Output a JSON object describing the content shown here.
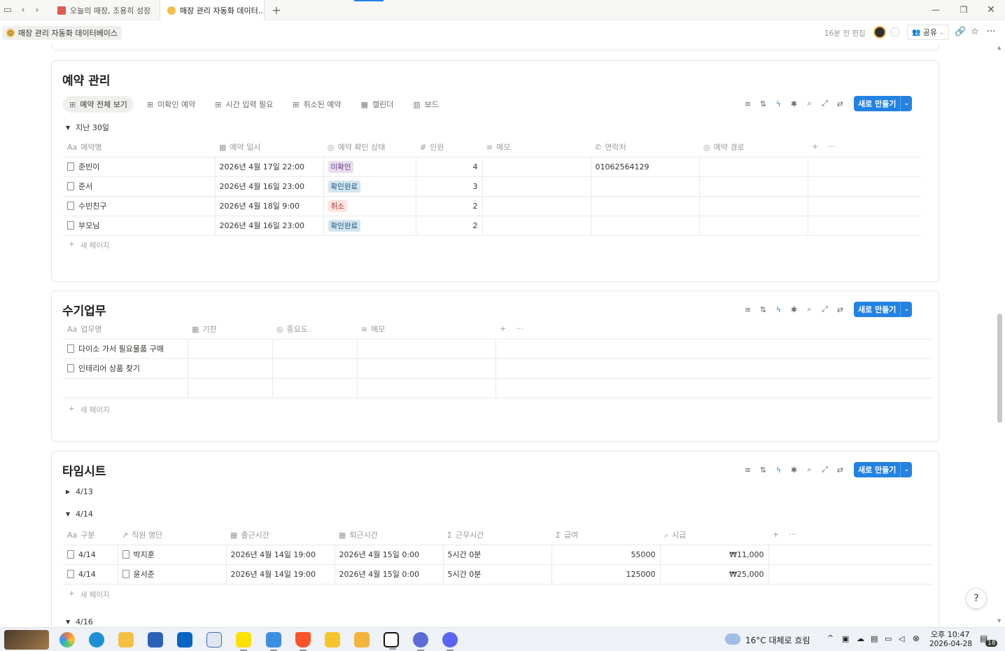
{
  "browser": {
    "tabs": [
      {
        "title": "오늘의 매장, 조용히 성장"
      },
      {
        "title": "매장 관리 자동화 데이터..."
      }
    ],
    "new_tab": "+"
  },
  "header": {
    "breadcrumb": "매장 관리 자동화 데이터베이스",
    "edited": "16분 전 편집",
    "share_label": "공유"
  },
  "common": {
    "new_button": "새로 만들기",
    "new_page": "새 페이지",
    "add_col": "+",
    "more": "···"
  },
  "reservations": {
    "title": "예약 관리",
    "views": [
      "예약 전체 보기",
      "미확인 예약",
      "시간 입력 필요",
      "취소된 예약",
      "캘린더",
      "보드"
    ],
    "group": "지난 30일",
    "columns": [
      "예약명",
      "예약 일시",
      "예약 확인 상태",
      "인원",
      "메모",
      "연락처",
      "예약 경로"
    ],
    "rows": [
      {
        "name": "준빈이",
        "datetime": "2026년 4월 17일 22:00",
        "status": "미확인",
        "status_color": "purple",
        "people": "4",
        "memo": "",
        "contact": "01062564129",
        "channel": ""
      },
      {
        "name": "준서",
        "datetime": "2026년 4월 16일 23:00",
        "status": "확인완료",
        "status_color": "blue",
        "people": "3",
        "memo": "",
        "contact": "",
        "channel": ""
      },
      {
        "name": "수빈친구",
        "datetime": "2026년 4월 18일 9:00",
        "status": "취소",
        "status_color": "red",
        "people": "2",
        "memo": "",
        "contact": "",
        "channel": ""
      },
      {
        "name": "부모님",
        "datetime": "2026년 4월 16일 23:00",
        "status": "확인완료",
        "status_color": "blue",
        "people": "2",
        "memo": "",
        "contact": "",
        "channel": ""
      }
    ]
  },
  "manual_tasks": {
    "title": "수기업무",
    "columns": [
      "업무명",
      "기한",
      "중요도",
      "메모"
    ],
    "rows": [
      {
        "name": "다이소 가서 필요물품 구매"
      },
      {
        "name": "인테리어 상품 찾기"
      },
      {
        "name": ""
      }
    ]
  },
  "timesheet": {
    "title": "타임시트",
    "groups": [
      "4/13",
      "4/14",
      "4/16"
    ],
    "columns": [
      "구분",
      "직원 명단",
      "출근시간",
      "퇴근시간",
      "근무시간",
      "급여",
      "시급"
    ],
    "rows": [
      {
        "label": "4/14",
        "employee": "박지훈",
        "in": "2026년 4월 14일 19:00",
        "out": "2026년 4월 15일 0:00",
        "hours": "5시간 0분",
        "pay": "55000",
        "wage": "₩11,000"
      },
      {
        "label": "4/14",
        "employee": "윤서준",
        "in": "2026년 4월 14일 19:00",
        "out": "2026년 4월 15일 0:00",
        "hours": "5시간 0분",
        "pay": "125000",
        "wage": "₩25,000"
      }
    ]
  },
  "taskbar": {
    "weather": "16°C 대체로 흐림",
    "time": "오후 10:47",
    "date": "2026-04-28",
    "notif_count": "18"
  },
  "colors": {
    "accent": "#2383e2"
  }
}
